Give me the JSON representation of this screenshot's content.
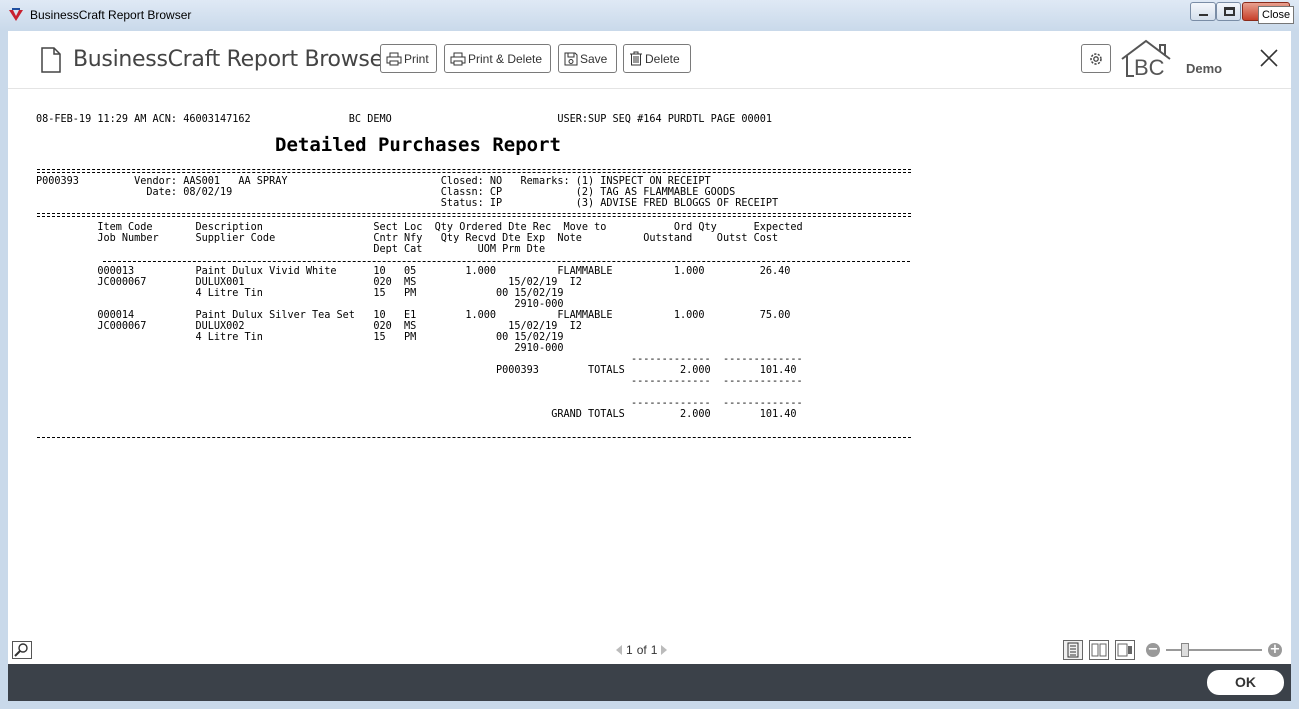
{
  "window": {
    "title": "BusinessCraft Report Browser",
    "close_tooltip": "Close"
  },
  "header": {
    "title": "BusinessCraft Report Browser",
    "buttons": {
      "print": "Print",
      "print_delete": "Print & Delete",
      "save": "Save",
      "delete": "Delete"
    },
    "logo_text": "BC",
    "logo_suffix": "Demo"
  },
  "report": {
    "line_header": "08-FEB-19 11:29 AM ACN: 46003147162                BC DEMO                           USER:SUP SEQ #164 PURDTL PAGE 00001",
    "title": "Detailed Purchases Report",
    "rows": [
      "P000393         Vendor: AAS001   AA SPRAY                         Closed: NO   Remarks: (1) INSPECT ON RECEIPT",
      "                  Date: 08/02/19                                  Classn: CP            (2) TAG AS FLAMMABLE GOODS",
      "                                                                  Status: IP            (3) ADVISE FRED BLOGGS OF RECEIPT",
      "          Item Code       Description                  Sect Loc  Qty Ordered Dte Rec  Move to           Ord Qty      Expected",
      "          Job Number      Supplier Code                Cntr Nfy   Qty Recvd Dte Exp  Note          Outstand    Outst Cost",
      "                                                       Dept Cat         UOM Prm Dte",
      "          000013          Paint Dulux Vivid White      10   05        1.000          FLAMMABLE          1.000         26.40",
      "          JC000067        DULUX001                     020  MS               15/02/19  I2",
      "                          4 Litre Tin                  15   PM             00 15/02/19",
      "                                                                              2910-000",
      "          000014          Paint Dulux Silver Tea Set   10   E1        1.000          FLAMMABLE          1.000         75.00",
      "          JC000067        DULUX002                     020  MS               15/02/19  I2",
      "                          4 Litre Tin                  15   PM             00 15/02/19",
      "                                                                              2910-000",
      "                                                                                                 -------------  -------------",
      "                                                                           P000393        TOTALS         2.000        101.40",
      "                                                                                                 -------------  -------------",
      "",
      "                                                                                                 -------------  -------------",
      "                                                                                    GRAND TOTALS         2.000        101.40"
    ]
  },
  "footer": {
    "page_current": "1",
    "page_of": "of",
    "page_total": "1",
    "ok": "OK"
  }
}
